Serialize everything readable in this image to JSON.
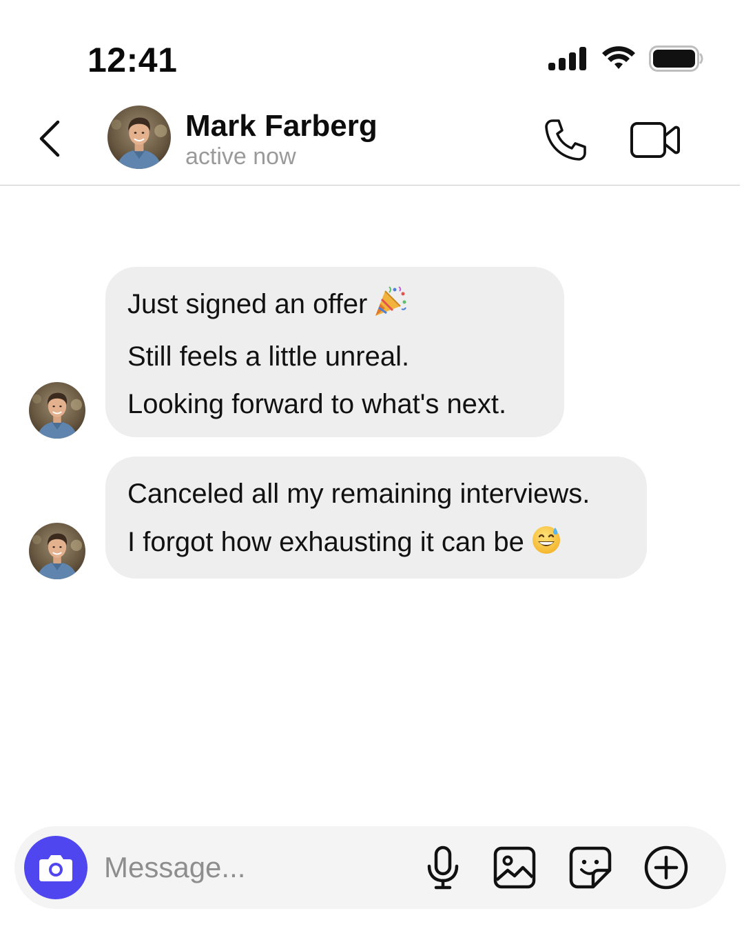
{
  "status_bar": {
    "time": "12:41",
    "icons": [
      "cellular-signal-icon",
      "wifi-icon",
      "battery-icon"
    ]
  },
  "header": {
    "back_icon": "chevron-left-icon",
    "contact_name": "Mark Farberg",
    "contact_status": "active now",
    "actions": [
      "phone-icon",
      "video-camera-icon"
    ]
  },
  "messages": [
    {
      "sender": "Mark Farberg",
      "lines": [
        {
          "text": "Just signed an offer",
          "emoji": "party-popper"
        },
        {
          "text": "Still feels a little unreal."
        },
        {
          "text": "Looking forward to what's next."
        }
      ]
    },
    {
      "sender": "Mark Farberg",
      "lines": [
        {
          "text": "Canceled all my remaining interviews."
        },
        {
          "text": "I forgot how exhausting it can be",
          "emoji": "grinning-face-with-sweat"
        }
      ]
    }
  ],
  "composer": {
    "placeholder": "Message...",
    "value": "",
    "tools": [
      "camera-icon",
      "microphone-icon",
      "image-icon",
      "sticker-icon",
      "plus-circle-icon"
    ]
  },
  "colors": {
    "accent": "#4f46f0",
    "bubble": "#eeeeee",
    "composer_bg": "#f4f4f4",
    "secondary_text": "#9a9a9a",
    "divider": "#c9c9c9"
  }
}
